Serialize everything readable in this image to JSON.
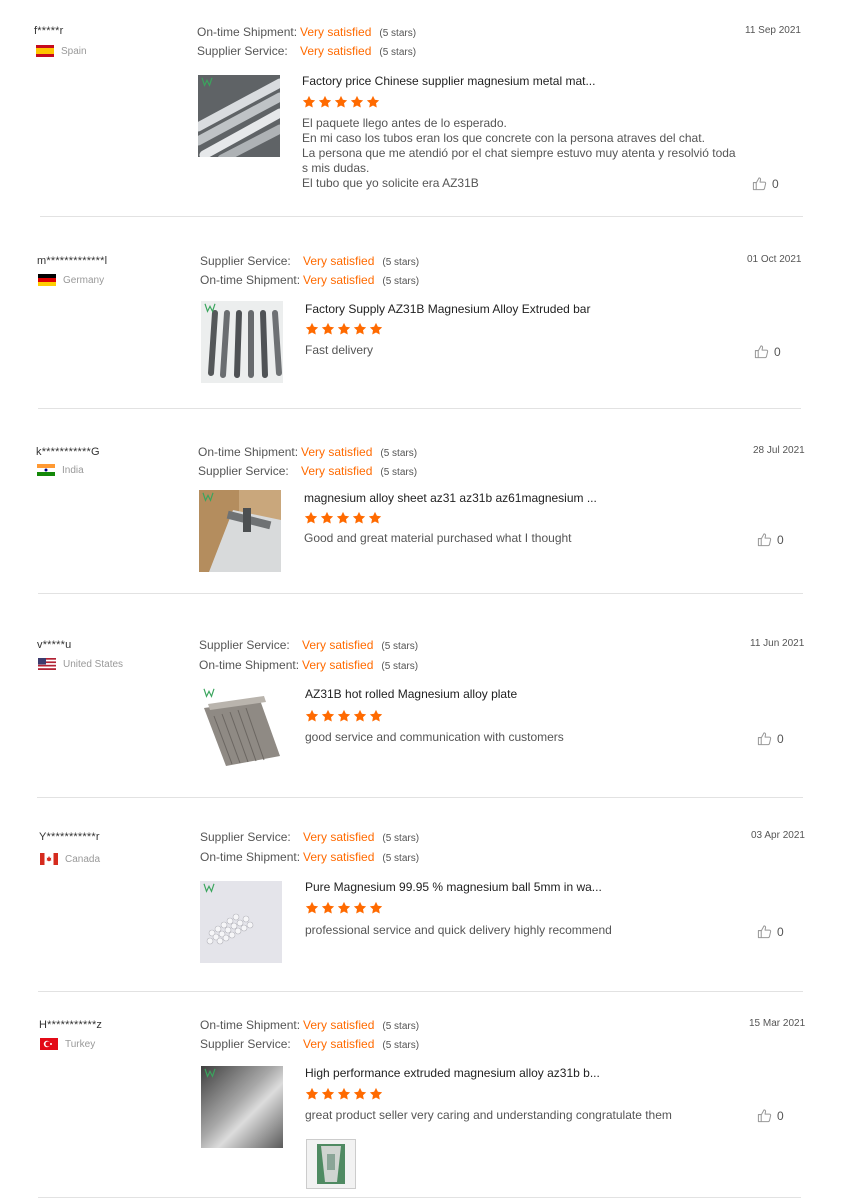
{
  "colors": {
    "accent": "#ff6a00",
    "separator": "#e2e2e2"
  },
  "icons": {
    "like": "thumbs-up-icon",
    "star": "star-icon"
  },
  "reviews": [
    {
      "user": "f*****r",
      "country": "Spain",
      "date": "11 Sep 2021",
      "ratings": [
        {
          "label": "On-time Shipment:",
          "value": "Very satisfied",
          "stars": "(5 stars)"
        },
        {
          "label": "Supplier Service:",
          "value": "Very satisfied",
          "stars": "(5 stars)"
        }
      ],
      "product_title": "Factory price Chinese supplier magnesium metal mat...",
      "product_stars": 5,
      "comment_lines": [
        "El paquete llego antes de lo esperado.",
        "En mi caso los tubos eran los que concrete con la persona atraves del chat.",
        "La persona que me atendió por el chat siempre estuvo muy atenta y resolvió toda",
        "s mis dudas.",
        "El tubo que yo solicite era AZ31B"
      ],
      "likes": "0"
    },
    {
      "user": "m*************l",
      "country": "Germany",
      "date": "01 Oct 2021",
      "ratings": [
        {
          "label": "Supplier Service:",
          "value": "Very satisfied",
          "stars": "(5 stars)"
        },
        {
          "label": "On-time Shipment:",
          "value": "Very satisfied",
          "stars": "(5 stars)"
        }
      ],
      "product_title": "Factory Supply AZ31B Magnesium Alloy Extruded bar",
      "product_stars": 5,
      "comment_lines": [
        "Fast delivery"
      ],
      "likes": "0"
    },
    {
      "user": "k***********G",
      "country": "India",
      "date": "28 Jul 2021",
      "ratings": [
        {
          "label": "On-time Shipment:",
          "value": "Very satisfied",
          "stars": "(5 stars)"
        },
        {
          "label": "Supplier Service:",
          "value": "Very satisfied",
          "stars": "(5 stars)"
        }
      ],
      "product_title": "magnesium alloy sheet az31 az31b az61magnesium ...",
      "product_stars": 5,
      "comment_lines": [
        "Good and great material purchased what I thought"
      ],
      "likes": "0"
    },
    {
      "user": "v*****u",
      "country": "United States",
      "date": "11 Jun 2021",
      "ratings": [
        {
          "label": "Supplier Service:",
          "value": "Very satisfied",
          "stars": "(5 stars)"
        },
        {
          "label": "On-time Shipment:",
          "value": "Very satisfied",
          "stars": "(5 stars)"
        }
      ],
      "product_title": "AZ31B hot rolled Magnesium alloy plate",
      "product_stars": 5,
      "comment_lines": [
        "good service and communication with customers"
      ],
      "likes": "0"
    },
    {
      "user": "Y***********r",
      "country": "Canada",
      "date": "03 Apr 2021",
      "ratings": [
        {
          "label": "Supplier Service:",
          "value": "Very satisfied",
          "stars": "(5 stars)"
        },
        {
          "label": "On-time Shipment:",
          "value": "Very satisfied",
          "stars": "(5 stars)"
        }
      ],
      "product_title": "Pure Magnesium 99.95 % magnesium ball 5mm in wa...",
      "product_stars": 5,
      "comment_lines": [
        "professional service and quick delivery highly recommend"
      ],
      "likes": "0"
    },
    {
      "user": "H***********z",
      "country": "Turkey",
      "date": "15 Mar 2021",
      "ratings": [
        {
          "label": "On-time Shipment:",
          "value": "Very satisfied",
          "stars": "(5 stars)"
        },
        {
          "label": "Supplier Service:",
          "value": "Very satisfied",
          "stars": "(5 stars)"
        }
      ],
      "product_title": "High performance extruded magnesium alloy az31b b...",
      "product_stars": 5,
      "comment_lines": [
        "great product seller very caring and understanding congratulate them"
      ],
      "likes": "0"
    }
  ]
}
